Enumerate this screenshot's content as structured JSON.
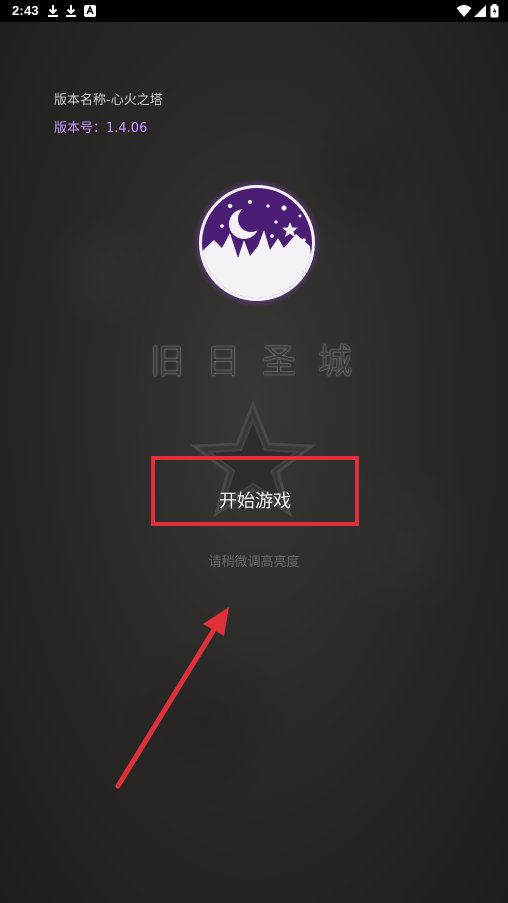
{
  "status_bar": {
    "time": "2:43",
    "left_icons": [
      "download-icon",
      "download-icon",
      "app-notification-icon"
    ],
    "right_icons": [
      "wifi-icon",
      "signal-icon",
      "battery-icon"
    ]
  },
  "version": {
    "name": "版本名称-心火之塔",
    "code": "版本号：1.4.06"
  },
  "title": "旧日圣城",
  "start_button": "开始游戏",
  "brightness_hint": "请稍微调高亮度",
  "colors": {
    "accent_purple": "#c79cff",
    "logo_purple": "#5a1f8a",
    "highlight_red": "#e0303a",
    "background": "#2d2b29"
  }
}
